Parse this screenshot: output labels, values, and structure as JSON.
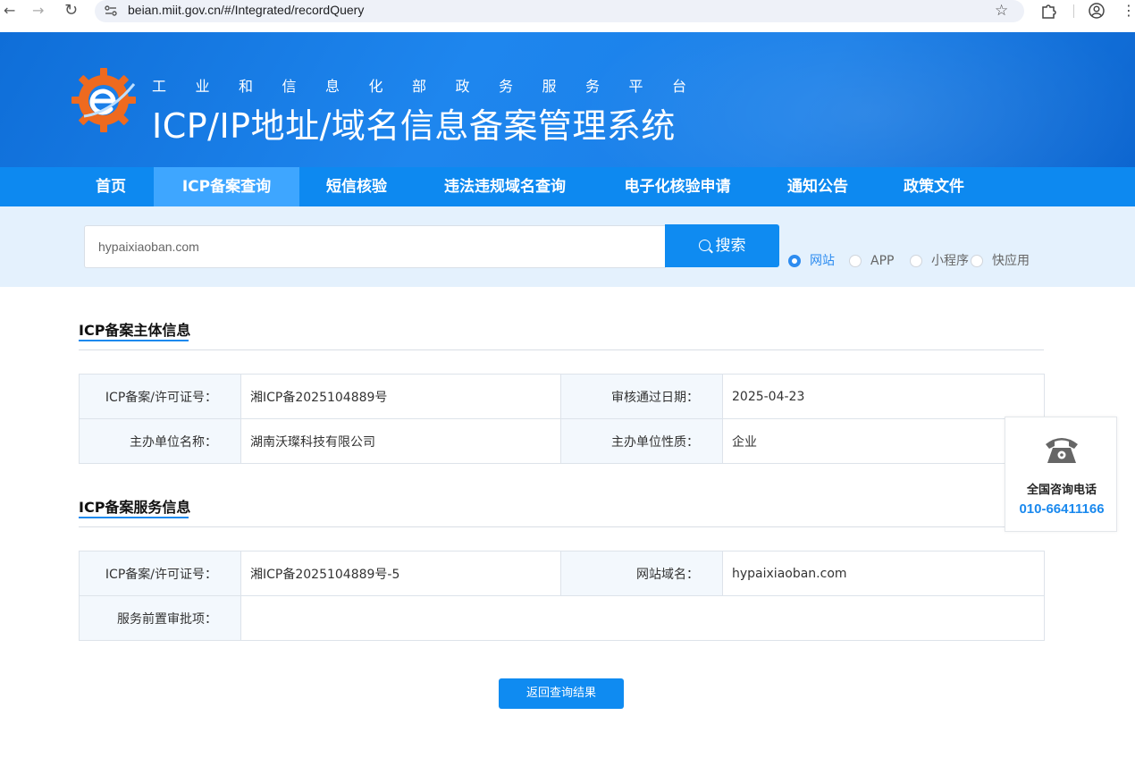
{
  "browser": {
    "url": "beian.miit.gov.cn/#/Integrated/recordQuery",
    "back": "←",
    "forward": "→",
    "reload": "↻",
    "menu": "⋮"
  },
  "header": {
    "subtitle": "工业和信息化部政务服务平台",
    "title": "ICP/IP地址/域名信息备案管理系统"
  },
  "nav": {
    "items": [
      {
        "label": "首页"
      },
      {
        "label": "ICP备案查询"
      },
      {
        "label": "短信核验"
      },
      {
        "label": "违法违规域名查询"
      },
      {
        "label": "电子化核验申请"
      },
      {
        "label": "通知公告"
      },
      {
        "label": "政策文件"
      }
    ],
    "active_index": 1
  },
  "search": {
    "value": "hypaixiaoban.com",
    "button_label": "搜索",
    "options": [
      {
        "label": "网站",
        "checked": true
      },
      {
        "label": "APP",
        "checked": false
      },
      {
        "label": "小程序",
        "checked": false
      },
      {
        "label": "快应用",
        "checked": false
      }
    ]
  },
  "subject_info": {
    "title": "ICP备案主体信息",
    "license_label": "ICP备案/许可证号：",
    "license_value": "湘ICP备2025104889号",
    "approval_date_label": "审核通过日期：",
    "approval_date_value": "2025-04-23",
    "organizer_name_label": "主办单位名称：",
    "organizer_name_value": "湖南沃璨科技有限公司",
    "organizer_type_label": "主办单位性质：",
    "organizer_type_value": "企业"
  },
  "service_info": {
    "title": "ICP备案服务信息",
    "license_label": "ICP备案/许可证号：",
    "license_value": "湘ICP备2025104889号-5",
    "domain_label": "网站域名：",
    "domain_value": "hypaixiaoban.com",
    "preapproval_label": "服务前置审批项：",
    "preapproval_value": ""
  },
  "phone_widget": {
    "label": "全国咨询电话",
    "number": "010-66411166"
  },
  "back_button_label": "返回查询结果",
  "colors": {
    "brand_blue": "#0d89f0",
    "active_tab": "#3ea6ff",
    "search_bg": "#e4f1fd",
    "accent": "#1a89ee",
    "logo_orange": "#ee6a1f"
  }
}
